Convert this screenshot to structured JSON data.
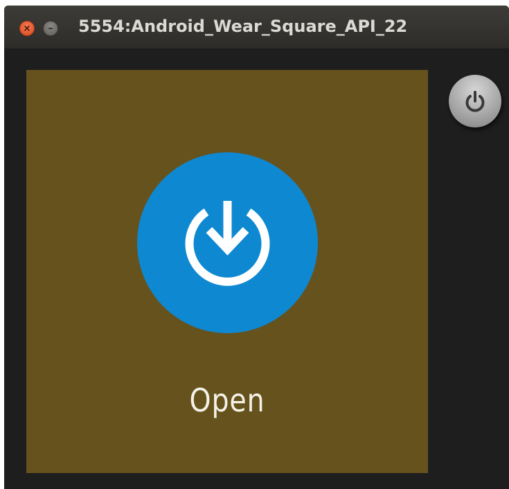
{
  "window": {
    "title": "5554:Android_Wear_Square_API_22",
    "close_glyph": "×",
    "minimize_glyph": "–"
  },
  "watch": {
    "background_color": "#66521d",
    "action_button": {
      "icon": "power-download-icon",
      "color": "#0f88d2"
    },
    "label": "Open"
  },
  "side_controls": {
    "power_button_icon": "power-icon"
  }
}
